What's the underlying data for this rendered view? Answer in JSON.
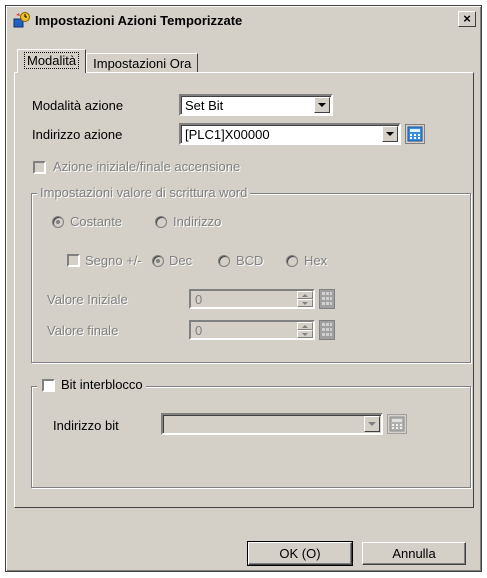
{
  "window": {
    "title": "Impostazioni Azioni Temporizzate",
    "close_glyph": "×"
  },
  "tabs": [
    {
      "label": "Modalità",
      "active": true
    },
    {
      "label": "Impostazioni Ora",
      "active": false
    }
  ],
  "form": {
    "action_mode_label": "Modalità azione",
    "action_mode_value": "Set Bit",
    "action_address_label": "Indirizzo azione",
    "action_address_value": "[PLC1]X00000",
    "power_action_label": "Azione iniziale/finale accensione"
  },
  "word_group": {
    "title": "Impostazioni valore di scrittura word",
    "constant_label": "Costante",
    "address_label": "Indirizzo",
    "sign_label": "Segno +/-",
    "dec_label": "Dec",
    "bcd_label": "BCD",
    "hex_label": "Hex",
    "initial_value_label": "Valore Iniziale",
    "initial_value": "0",
    "final_value_label": "Valore finale",
    "final_value": "0"
  },
  "interlock": {
    "title": "Bit interblocco",
    "bit_address_label": "Indirizzo bit",
    "bit_address_value": ""
  },
  "buttons": {
    "ok": "OK (O)",
    "cancel": "Annulla"
  }
}
